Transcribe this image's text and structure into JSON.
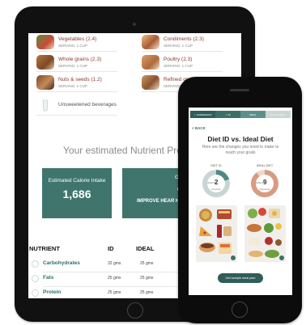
{
  "tablet": {
    "food_groups": [
      {
        "name": "Vegetables (2.4)",
        "serving": "SERVING: 1 CUP",
        "icon": "vegetables-icon"
      },
      {
        "name": "Condiments (2.3)",
        "serving": "SERVING: 1 CUP",
        "icon": "condiments-icon"
      },
      {
        "name": "Whole grains (2.3)",
        "serving": "SERVING: 1 CUP",
        "icon": "whole-grains-icon"
      },
      {
        "name": "Poultry (2.3)",
        "serving": "SERVING: 1 CUP",
        "icon": "poultry-icon"
      },
      {
        "name": "Nuts & seeds (1.2)",
        "serving": "SERVING: 1 CUP",
        "icon": "nuts-seeds-icon"
      },
      {
        "name": "Refined grains",
        "serving": "SERVING: 1 CUP",
        "icon": "refined-grains-icon"
      },
      {
        "name": "Unsweetened beverages",
        "serving": "",
        "icon": "beverage-icon"
      }
    ],
    "nutrient_title": "Your estimated Nutrient Prof",
    "calorie_card": {
      "label": "Estimated Calorie Intake",
      "value": "1,686"
    },
    "goals_card": {
      "label": "Goals",
      "goal": "IMPROVE HEAR HEALTH",
      "icon": "heart-check-icon"
    },
    "table_headers": {
      "nutrient": "NUTRIENT",
      "id": "ID",
      "ideal": "IDEAL"
    },
    "nutrients": [
      {
        "name": "Carbohydrates",
        "id": "32 gms",
        "ideal": "25 gms"
      },
      {
        "name": "Fats",
        "id": "25 gms",
        "ideal": "25 gms"
      },
      {
        "name": "Protein",
        "id": "25 gms",
        "ideal": "25 gms"
      }
    ]
  },
  "phone": {
    "steps": [
      "✓ SCREENERS",
      "✓ ID",
      "IDEAL",
      "RECOMMEND"
    ],
    "back_label": "< BACK",
    "title": "Diet ID vs. Ideal Diet",
    "subtitle": "Here are the changes you need to make to reach your goals",
    "diet_id": {
      "label": "DIET ID",
      "quality_label": "QUALITY",
      "quality": "2",
      "type": "American"
    },
    "ideal_diet": {
      "label": "IDEAL DIET",
      "quality_label": "QUALITY",
      "quality": "9",
      "type": "Vegetarian"
    },
    "button_label": "Get sample meal plan",
    "colors": {
      "teal": "#2f5d58",
      "gauge_id": "#4f8a85",
      "gauge_ideal": "#d99b82"
    }
  }
}
